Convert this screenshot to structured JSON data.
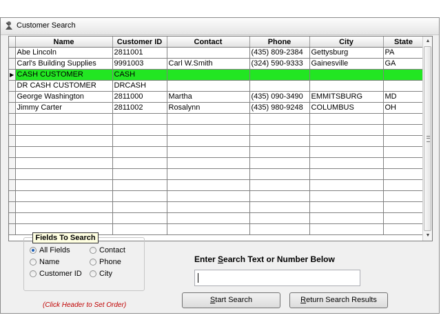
{
  "window": {
    "title": "Customer Search"
  },
  "grid": {
    "columns": [
      "Name",
      "Customer ID",
      "Contact",
      "Phone",
      "City",
      "State"
    ],
    "rows": [
      {
        "name": "Abe Lincoln",
        "id": "2811001",
        "contact": "",
        "phone": "(435) 809-2384",
        "city": "Gettysburg",
        "state": "PA"
      },
      {
        "name": "Carl's Building Supplies",
        "id": "9991003",
        "contact": "Carl W.Smith",
        "phone": "(324) 590-9333",
        "city": "Gainesville",
        "state": "GA"
      },
      {
        "name": "CASH CUSTOMER",
        "id": "CASH",
        "contact": "",
        "phone": "",
        "city": "",
        "state": ""
      },
      {
        "name": "DR CASH CUSTOMER",
        "id": "DRCASH",
        "contact": "",
        "phone": "",
        "city": "",
        "state": ""
      },
      {
        "name": "George Washington",
        "id": "2811000",
        "contact": "Martha",
        "phone": "(435) 090-3490",
        "city": "EMMITSBURG",
        "state": "MD"
      },
      {
        "name": "Jimmy Carter",
        "id": "2811002",
        "contact": "Rosalynn",
        "phone": "(435) 980-9248",
        "city": "COLUMBUS",
        "state": "OH"
      }
    ],
    "selected_row_color": "#22e622",
    "row_indicator": "▶"
  },
  "fields_to_search": {
    "legend": "Fields To Search",
    "options": [
      {
        "label": "All Fields",
        "checked": true
      },
      {
        "label": "Name",
        "checked": false
      },
      {
        "label": "Customer ID",
        "checked": false
      },
      {
        "label": "Contact",
        "checked": false
      },
      {
        "label": "Phone",
        "checked": false
      },
      {
        "label": "City",
        "checked": false
      }
    ],
    "hint": "(Click Header to Set Order)"
  },
  "search": {
    "label_prefix": "Enter ",
    "label_accel": "S",
    "label_rest": "earch Text or Number Below",
    "value": ""
  },
  "buttons": {
    "start_accel": "S",
    "start_rest": "tart Search",
    "return_accel": "R",
    "return_rest": "eturn Search Results"
  }
}
